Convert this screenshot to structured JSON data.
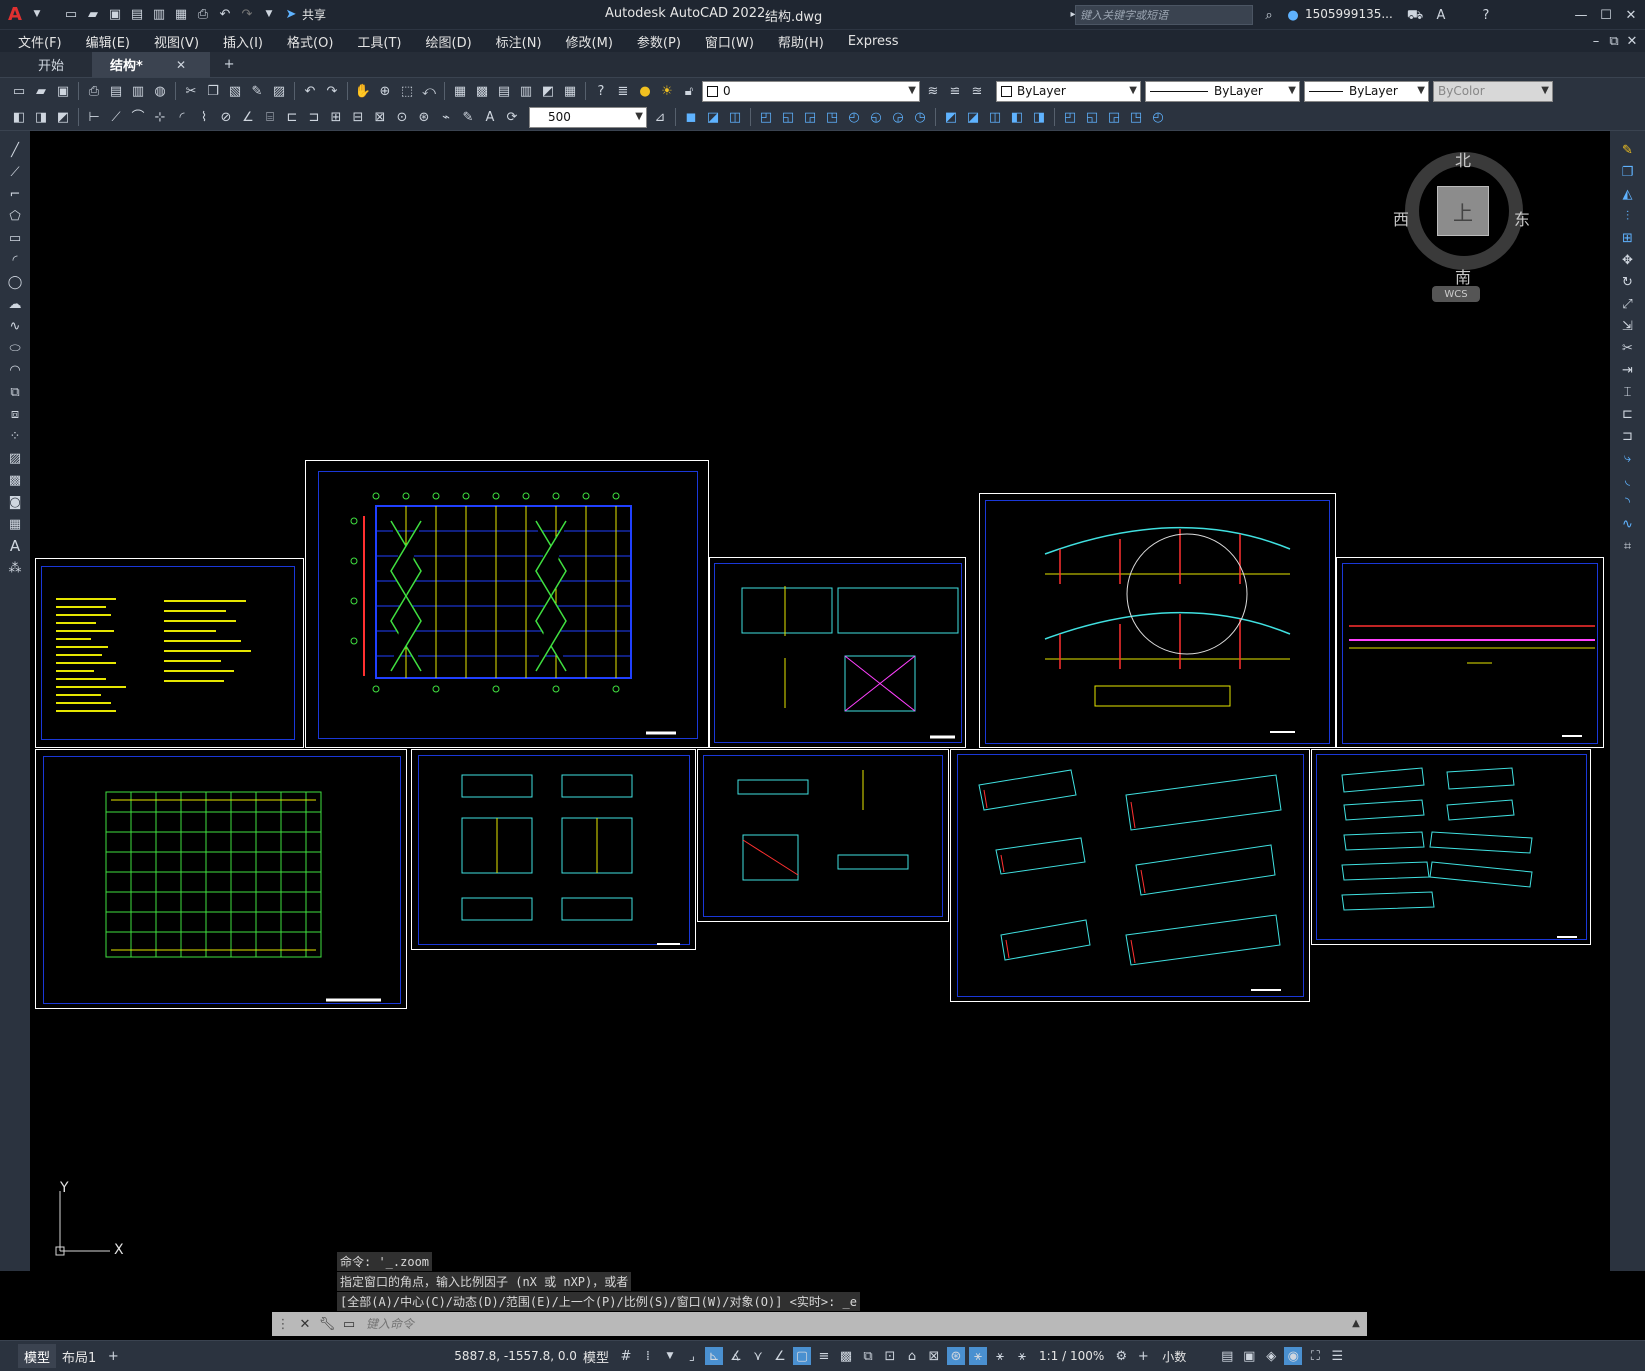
{
  "title": {
    "app": "Autodesk AutoCAD 2022",
    "file": "结构.dwg",
    "search_placeholder": "键入关键字或短语",
    "user": "1505999135...",
    "share": "共享"
  },
  "menus": [
    "文件(F)",
    "编辑(E)",
    "视图(V)",
    "插入(I)",
    "格式(O)",
    "工具(T)",
    "绘图(D)",
    "标注(N)",
    "修改(M)",
    "参数(P)",
    "窗口(W)",
    "帮助(H)",
    "Express"
  ],
  "tabs": [
    {
      "label": "开始"
    },
    {
      "label": "结构*"
    }
  ],
  "layer": {
    "current": "0"
  },
  "props": {
    "color": "ByLayer",
    "linetype": "ByLayer",
    "lineweight": "ByLayer",
    "plotstyle": "ByColor"
  },
  "dimscale": "500",
  "viewcube": {
    "north": "北",
    "south": "南",
    "east": "东",
    "west": "西",
    "face": "上",
    "wcs": "WCS"
  },
  "ucs": {
    "y": "Y",
    "x": "X"
  },
  "command": {
    "history": [
      "命令: '_.zoom",
      "指定窗口的角点，输入比例因子 (nX 或 nXP)，或者",
      "[全部(A)/中心(C)/动态(D)/范围(E)/上一个(P)/比例(S)/窗口(W)/对象(O)] <实时>: _e"
    ],
    "placeholder": "键入命令"
  },
  "layouts": [
    {
      "label": "模型"
    },
    {
      "label": "布局1"
    }
  ],
  "status": {
    "coords": "5887.8, -1557.8, 0.0",
    "space": "模型",
    "scale": "1:1 / 100%",
    "units": "小数"
  },
  "colors": {
    "sheet_border": "#ffffff",
    "inner_border": "#1a38d8",
    "accent": "#4a90d0"
  }
}
